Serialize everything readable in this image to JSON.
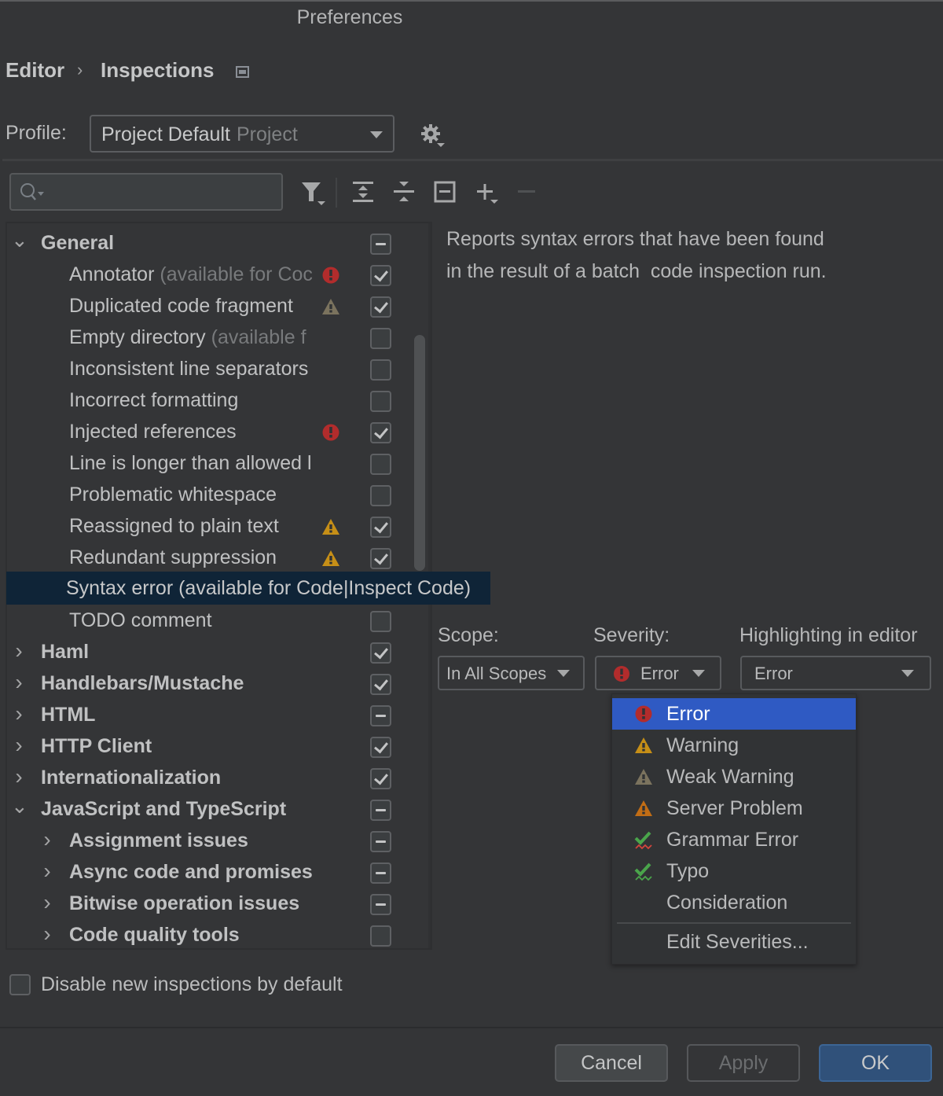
{
  "window": {
    "title": "Preferences"
  },
  "breadcrumb": {
    "parent": "Editor",
    "separator": "›",
    "current": "Inspections"
  },
  "profile": {
    "label": "Profile:",
    "value": "Project Default",
    "sub": "Project"
  },
  "search": {
    "placeholder": ""
  },
  "toolbar": {
    "icons": [
      "filter-icon",
      "expand-all-icon",
      "collapse-all-icon",
      "reset-icon",
      "add-icon",
      "remove-icon"
    ]
  },
  "colors": {
    "error": "#b22c2c",
    "warning": "#c68f17",
    "weak_warning": "#7b735e",
    "server_problem": "#c16d15",
    "grammar_check": "#4aa54b",
    "selection": "#2f5ac3",
    "tree_selection": "#0f2437"
  },
  "tree": {
    "rows": [
      {
        "label": "General",
        "hint": "",
        "level": 0,
        "expanded": true,
        "bold": true,
        "severity": "",
        "check": "partial"
      },
      {
        "label": "Annotator",
        "hint": "(available for Coc",
        "level": 1,
        "bold": false,
        "severity": "error",
        "check": "checked"
      },
      {
        "label": "Duplicated code fragment",
        "hint": "",
        "level": 1,
        "bold": false,
        "severity": "weak",
        "check": "checked"
      },
      {
        "label": "Empty directory",
        "hint": "(available f",
        "level": 1,
        "bold": false,
        "severity": "",
        "check": "unchecked"
      },
      {
        "label": "Inconsistent line separators",
        "hint": "",
        "level": 1,
        "bold": false,
        "severity": "",
        "check": "unchecked"
      },
      {
        "label": "Incorrect formatting",
        "hint": "",
        "level": 1,
        "bold": false,
        "severity": "",
        "check": "unchecked"
      },
      {
        "label": "Injected references",
        "hint": "",
        "level": 1,
        "bold": false,
        "severity": "error",
        "check": "checked"
      },
      {
        "label": "Line is longer than allowed l",
        "hint": "",
        "level": 1,
        "bold": false,
        "severity": "",
        "check": "unchecked"
      },
      {
        "label": "Problematic whitespace",
        "hint": "",
        "level": 1,
        "bold": false,
        "severity": "",
        "check": "unchecked"
      },
      {
        "label": "Reassigned to plain text",
        "hint": "",
        "level": 1,
        "bold": false,
        "severity": "warning",
        "check": "checked"
      },
      {
        "label": "Redundant suppression",
        "hint": "",
        "level": 1,
        "bold": false,
        "severity": "warning",
        "check": "checked"
      },
      {
        "label": "",
        "hint": "",
        "level": 1,
        "bold": false,
        "severity": "",
        "check": "none"
      },
      {
        "label": "TODO comment",
        "hint": "",
        "level": 1,
        "bold": false,
        "severity": "",
        "check": "unchecked"
      },
      {
        "label": "Haml",
        "hint": "",
        "level": 0,
        "expanded": false,
        "bold": true,
        "severity": "",
        "check": "checked"
      },
      {
        "label": "Handlebars/Mustache",
        "hint": "",
        "level": 0,
        "expanded": false,
        "bold": true,
        "severity": "",
        "check": "checked"
      },
      {
        "label": "HTML",
        "hint": "",
        "level": 0,
        "expanded": false,
        "bold": true,
        "severity": "",
        "check": "partial"
      },
      {
        "label": "HTTP Client",
        "hint": "",
        "level": 0,
        "expanded": false,
        "bold": true,
        "severity": "",
        "check": "checked"
      },
      {
        "label": "Internationalization",
        "hint": "",
        "level": 0,
        "expanded": false,
        "bold": true,
        "severity": "",
        "check": "checked"
      },
      {
        "label": "JavaScript and TypeScript",
        "hint": "",
        "level": 0,
        "expanded": true,
        "bold": true,
        "severity": "",
        "check": "partial"
      },
      {
        "label": "Assignment issues",
        "hint": "",
        "level": 1,
        "expanded": false,
        "bold": true,
        "severity": "",
        "check": "partial"
      },
      {
        "label": "Async code and promises",
        "hint": "",
        "level": 1,
        "expanded": false,
        "bold": true,
        "severity": "",
        "check": "partial"
      },
      {
        "label": "Bitwise operation issues",
        "hint": "",
        "level": 1,
        "expanded": false,
        "bold": true,
        "severity": "",
        "check": "partial"
      },
      {
        "label": "Code quality tools",
        "hint": "",
        "level": 1,
        "expanded": false,
        "bold": true,
        "severity": "",
        "check": "unchecked"
      }
    ],
    "selected": {
      "label": "Syntax error (available for Code|Inspect Code)"
    }
  },
  "description": {
    "line1": "Reports syntax errors that have been found",
    "line2": "in the result of a batch  code inspection run."
  },
  "options": {
    "scope_label": "Scope:",
    "scope_value": "In All Scopes",
    "severity_label": "Severity:",
    "severity_value": "Error",
    "highlight_label": "Highlighting in editor",
    "highlight_value": "Error"
  },
  "severity_popup": {
    "items": [
      {
        "label": "Error",
        "icon": "error",
        "active": true
      },
      {
        "label": "Warning",
        "icon": "warning",
        "active": false
      },
      {
        "label": "Weak Warning",
        "icon": "weak",
        "active": false
      },
      {
        "label": "Server Problem",
        "icon": "server",
        "active": false
      },
      {
        "label": "Grammar Error",
        "icon": "grammar",
        "active": false
      },
      {
        "label": "Typo",
        "icon": "typo",
        "active": false
      },
      {
        "label": "Consideration",
        "icon": "",
        "active": false
      }
    ],
    "edit": "Edit Severities..."
  },
  "disable_new": {
    "label": "Disable new inspections by default",
    "checked": false
  },
  "buttons": {
    "cancel": "Cancel",
    "apply": "Apply",
    "ok": "OK"
  }
}
